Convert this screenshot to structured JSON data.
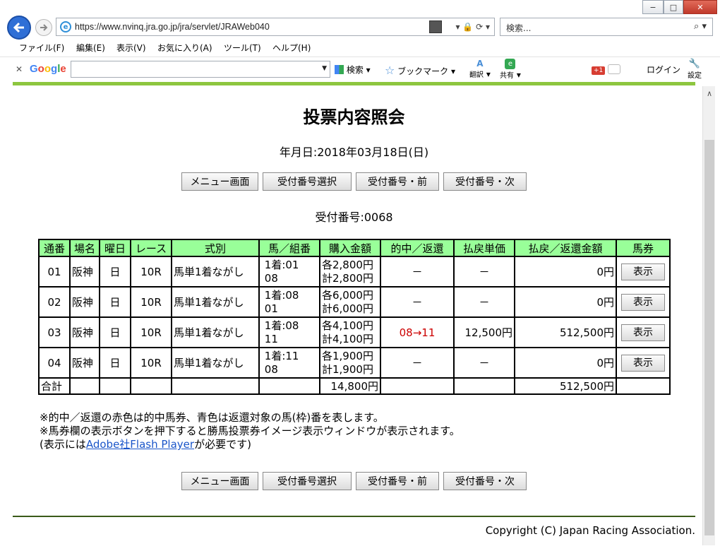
{
  "browser": {
    "url": "https://www.nvinq.jra.go.jp/jra/servlet/JRAWeb040",
    "search_placeholder": "検索...",
    "menu": [
      "ファイル(F)",
      "編集(E)",
      "表示(V)",
      "お気に入り(A)",
      "ツール(T)",
      "ヘルプ(H)"
    ],
    "google": {
      "logo": "Google",
      "search_label": "検索",
      "bookmark_label": "ブックマーク",
      "translate_label": "翻訳",
      "share_label": "共有",
      "login_label": "ログイン",
      "settings_label": "設定",
      "gplus_label": "+1"
    }
  },
  "page": {
    "title": "投票内容照会",
    "date_line": "年月日:2018年03月18日(日)",
    "buttons": {
      "menu": "メニュー画面",
      "select": "受付番号選択",
      "prev": "受付番号・前",
      "next": "受付番号・次"
    },
    "receipt_line": "受付番号:0068",
    "table": {
      "headers": [
        "通番",
        "場名",
        "曜日",
        "レース",
        "式別",
        "馬／組番",
        "購入金額",
        "的中／返還",
        "払戻単価",
        "払戻／返還金額",
        "馬券"
      ],
      "rows": [
        {
          "no": "01",
          "venue": "阪神",
          "day": "日",
          "race": "10R",
          "type": "馬単1着ながし",
          "combo1": "1着:01",
          "combo2": "08",
          "amt1": "各2,800円",
          "amt2": "計2,800円",
          "hit": "－",
          "unit": "－",
          "payout": "0円",
          "ticket": "表示"
        },
        {
          "no": "02",
          "venue": "阪神",
          "day": "日",
          "race": "10R",
          "type": "馬単1着ながし",
          "combo1": "1着:08",
          "combo2": "01",
          "amt1": "各6,000円",
          "amt2": "計6,000円",
          "hit": "－",
          "unit": "－",
          "payout": "0円",
          "ticket": "表示"
        },
        {
          "no": "03",
          "venue": "阪神",
          "day": "日",
          "race": "10R",
          "type": "馬単1着ながし",
          "combo1": "1着:08",
          "combo2": "11",
          "amt1": "各4,100円",
          "amt2": "計4,100円",
          "hit": "08→11",
          "unit": "12,500円",
          "payout": "512,500円",
          "ticket": "表示"
        },
        {
          "no": "04",
          "venue": "阪神",
          "day": "日",
          "race": "10R",
          "type": "馬単1着ながし",
          "combo1": "1着:11",
          "combo2": "08",
          "amt1": "各1,900円",
          "amt2": "計1,900円",
          "hit": "－",
          "unit": "－",
          "payout": "0円",
          "ticket": "表示"
        }
      ],
      "total": {
        "label": "合計",
        "amount": "14,800円",
        "payout": "512,500円"
      }
    },
    "notes": {
      "line1": "※的中／返還の赤色は的中馬券、青色は返還対象の馬(枠)番を表します。",
      "line2": "※馬券欄の表示ボタンを押下すると勝馬投票券イメージ表示ウィンドウが表示されます。",
      "line3_pre": "(表示には",
      "line3_link": "Adobe社Flash Player",
      "line3_post": "が必要です)"
    },
    "copyright": "Copyright (C) Japan Racing Association."
  },
  "colors": {
    "header_bg": "#99ff99",
    "hit_red": "#cc0000",
    "link_blue": "#1a55c9",
    "toolbar_green": "#8dc63f"
  }
}
